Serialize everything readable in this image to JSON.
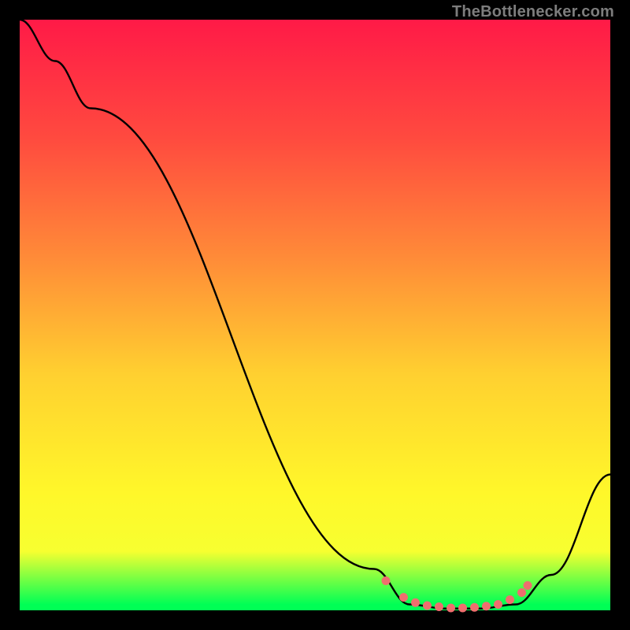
{
  "attribution": "TheBottlenecker.com",
  "chart_data": {
    "type": "line",
    "title": "",
    "xlabel": "",
    "ylabel": "",
    "xlim": [
      0,
      100
    ],
    "ylim": [
      0,
      100
    ],
    "series": [
      {
        "name": "bottleneck-curve",
        "x": [
          0,
          6,
          12,
          60,
          66,
          72,
          78,
          84,
          90,
          100
        ],
        "y": [
          100,
          93,
          85,
          7,
          1,
          0.3,
          0.3,
          1,
          6,
          23
        ]
      }
    ],
    "markers": {
      "name": "optimal-range",
      "color": "#ef6e6e",
      "points_x": [
        62,
        65,
        67,
        69,
        71,
        73,
        75,
        77,
        79,
        81,
        83,
        85,
        86
      ],
      "points_y": [
        5,
        2.2,
        1.3,
        0.8,
        0.6,
        0.4,
        0.4,
        0.5,
        0.7,
        1.0,
        1.8,
        3.0,
        4.2
      ]
    },
    "colors": {
      "curve": "#000000",
      "marker": "#ef6e6e",
      "bg_top": "#ff1a47",
      "bg_bottom": "#00ff55"
    }
  }
}
